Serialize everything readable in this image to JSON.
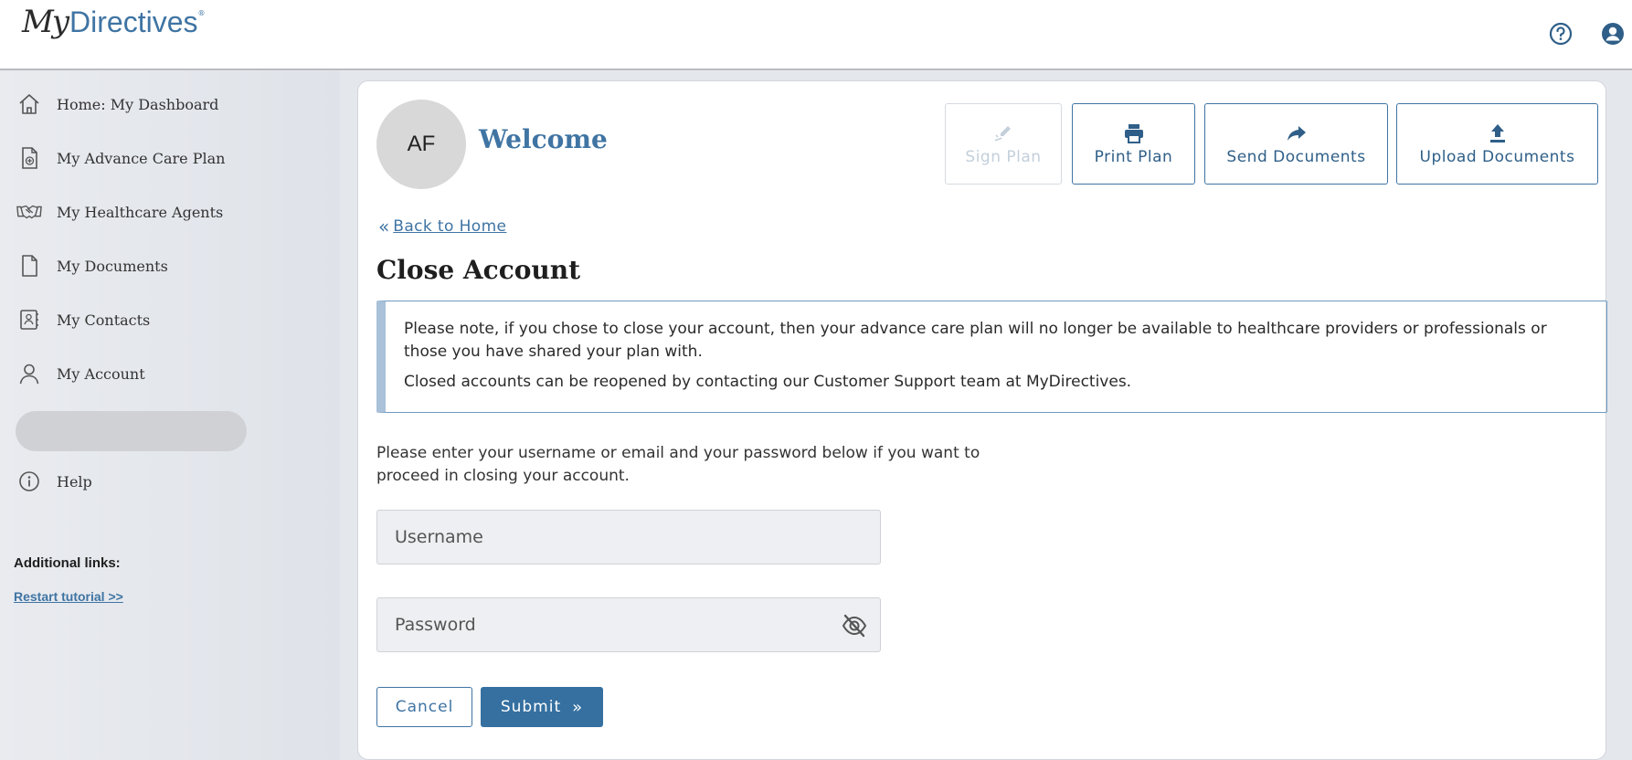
{
  "header": {
    "logo": {
      "part1": "My",
      "part2": "Directives",
      "reg": "®"
    },
    "help_icon": "help-circle-icon",
    "user_icon": "user-circle-icon"
  },
  "sidebar": {
    "items": [
      {
        "label": "Home: My Dashboard",
        "icon": "home-icon"
      },
      {
        "label": "My Advance Care Plan",
        "icon": "medical-document-icon"
      },
      {
        "label": "My Healthcare Agents",
        "icon": "handshake-icon"
      },
      {
        "label": "My Documents",
        "icon": "document-icon"
      },
      {
        "label": "My Contacts",
        "icon": "contacts-book-icon"
      },
      {
        "label": "My Account",
        "icon": "user-icon"
      }
    ],
    "help": {
      "label": "Help",
      "icon": "info-circle-icon"
    },
    "additional_links_label": "Additional links:",
    "restart_tutorial": "Restart tutorial >>"
  },
  "main": {
    "avatar_initials": "AF",
    "welcome": "Welcome",
    "actions": {
      "sign": "Sign Plan",
      "print": "Print Plan",
      "send": "Send Documents",
      "upload": "Upload Documents"
    },
    "back_link": "Back to Home",
    "title": "Close Account",
    "notice": {
      "line1": "Please note, if you chose to close your account, then your advance care plan will no longer be available to healthcare providers or professionals or those you have shared your plan with.",
      "line2": "Closed accounts can be reopened by contacting our Customer Support team at MyDirectives."
    },
    "instructions": "Please enter your username or email and your password below if you want to proceed in closing your account.",
    "username_placeholder": "Username",
    "password_placeholder": "Password",
    "cancel_label": "Cancel",
    "submit_label": "Submit"
  },
  "colors": {
    "brand_blue": "#3f74a3",
    "submit_bg": "#3570a0"
  }
}
